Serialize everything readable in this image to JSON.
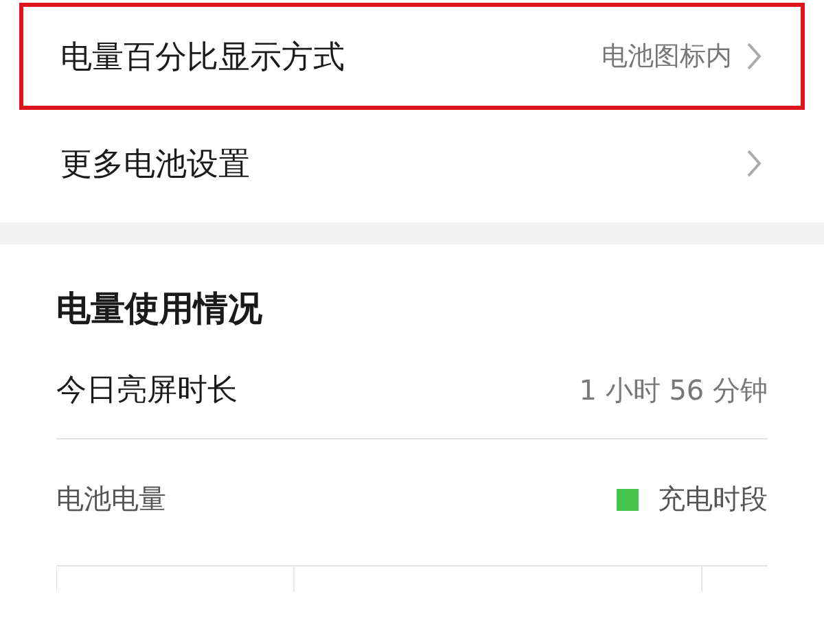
{
  "settings": [
    {
      "label": "电量百分比显示方式",
      "value": "电池图标内",
      "highlighted": true
    },
    {
      "label": "更多电池设置",
      "highlighted": false
    }
  ],
  "usage": {
    "title": "电量使用情况",
    "screen_time": {
      "label": "今日亮屏时长",
      "value": "1 小时 56 分钟"
    },
    "battery_chart": {
      "label": "电池电量",
      "legend": {
        "label": "充电时段",
        "color": "#44c24a"
      }
    }
  }
}
